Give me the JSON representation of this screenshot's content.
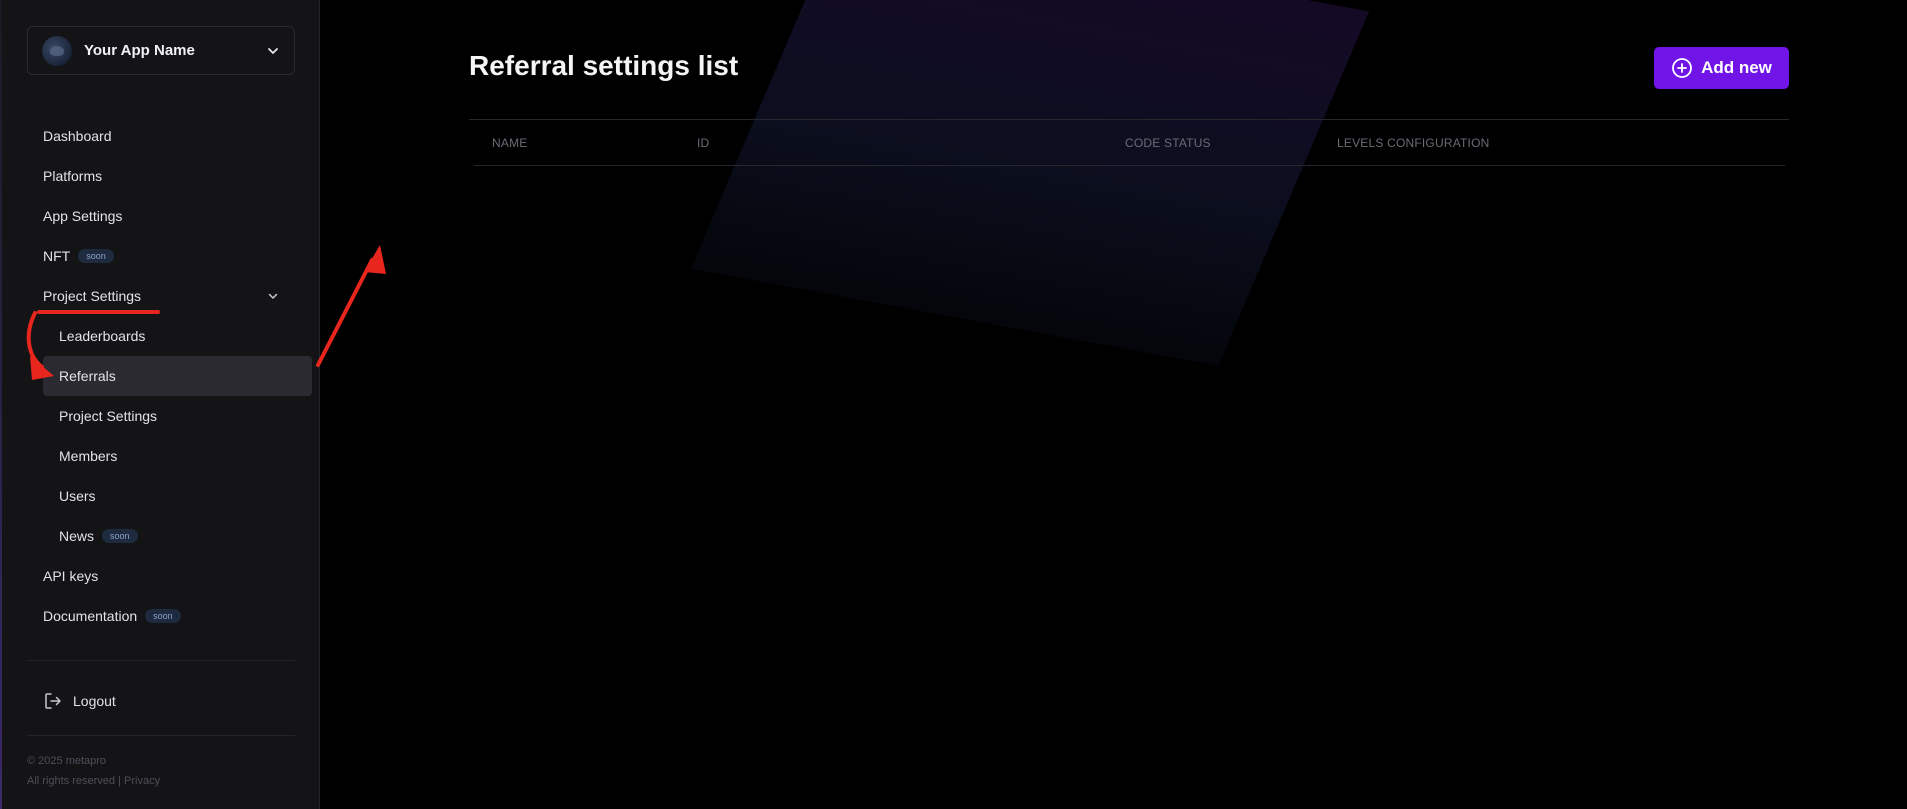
{
  "app": {
    "name": "Your App Name"
  },
  "sidebar": {
    "items": [
      {
        "label": "Dashboard"
      },
      {
        "label": "Platforms"
      },
      {
        "label": "App Settings"
      },
      {
        "label": "NFT",
        "badge": "soon"
      },
      {
        "label": "Project Settings"
      },
      {
        "label": "Leaderboards"
      },
      {
        "label": "Referrals"
      },
      {
        "label": "Project Settings"
      },
      {
        "label": "Members"
      },
      {
        "label": "Users"
      },
      {
        "label": "News",
        "badge": "soon"
      },
      {
        "label": "API keys"
      },
      {
        "label": "Documentation",
        "badge": "soon"
      }
    ],
    "logout_label": "Logout",
    "footer": {
      "copyright": "© 2025 metapro",
      "rights": "All rights reserved |",
      "privacy": "Privacy"
    }
  },
  "main": {
    "title": "Referral settings list",
    "add_button_label": "Add new",
    "table": {
      "columns": [
        "NAME",
        "ID",
        "CODE STATUS",
        "LEVELS CONFIGURATION"
      ],
      "rows": []
    }
  },
  "colors": {
    "accent": "#7014e8",
    "annotation": "#e8261e",
    "sidebar_bg": "#141417",
    "active_item_bg": "#2a2a30"
  }
}
